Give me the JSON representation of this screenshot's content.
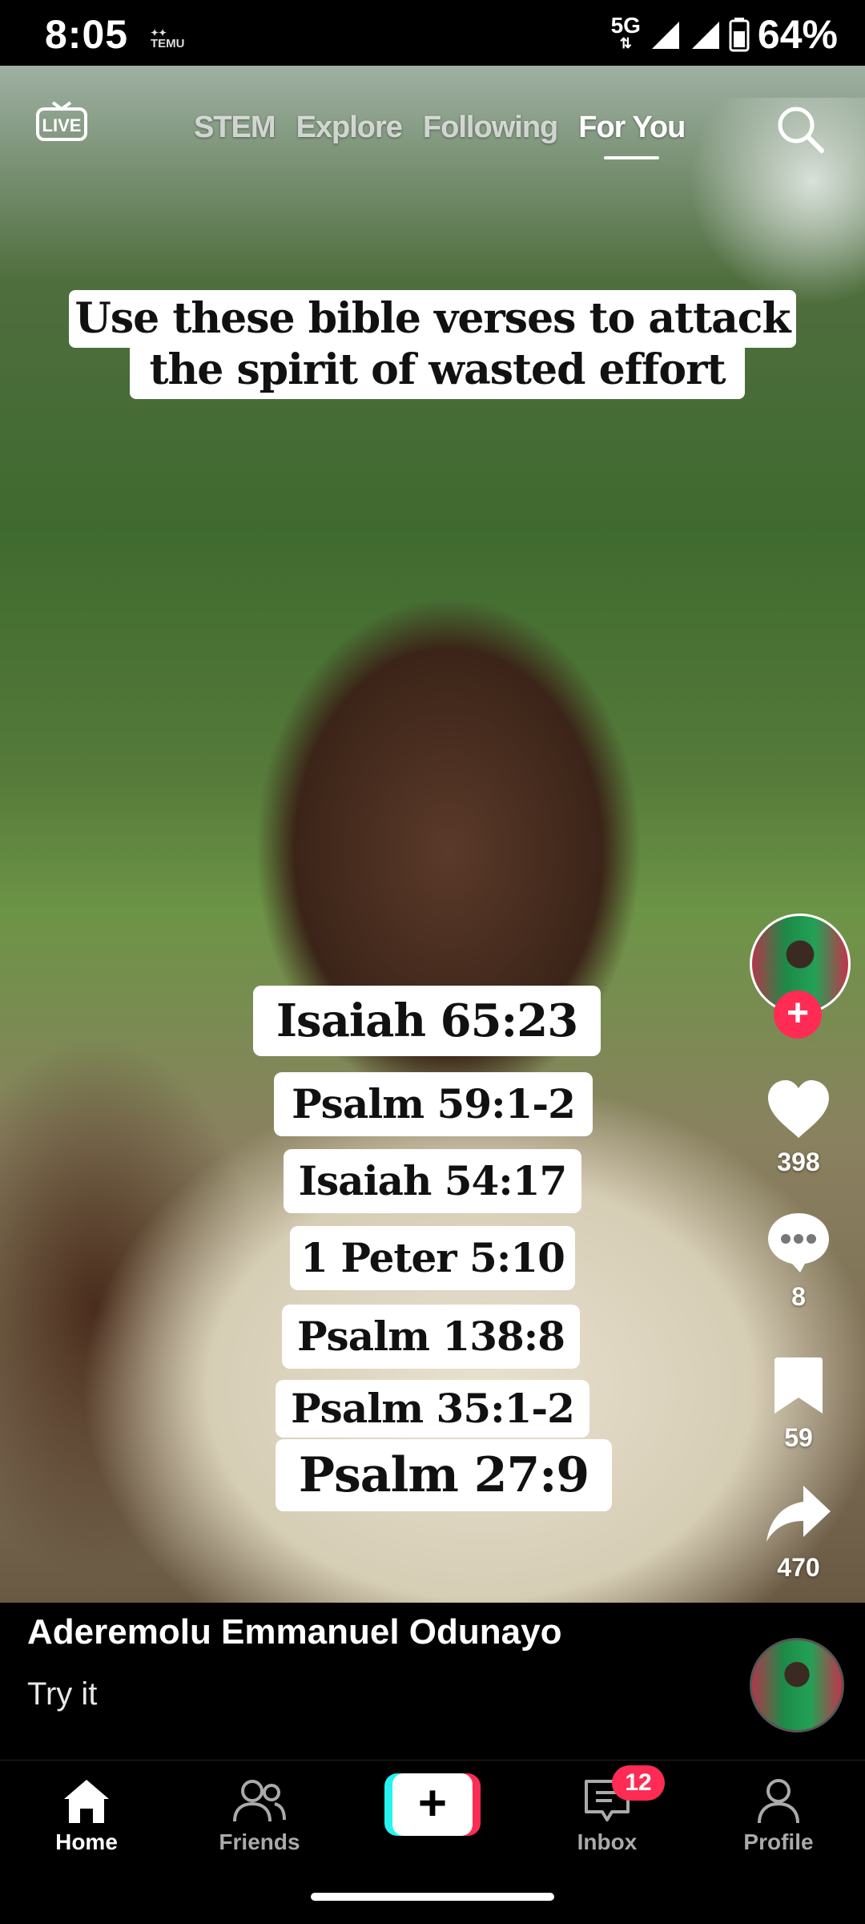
{
  "status_bar": {
    "time": "8:05",
    "notif_app": "TEMU",
    "network": "5G",
    "battery": "64%"
  },
  "top_nav": {
    "live_label": "LIVE",
    "tabs": [
      {
        "label": "STEM",
        "active": false
      },
      {
        "label": "Explore",
        "active": false
      },
      {
        "label": "Following",
        "active": false
      },
      {
        "label": "For You",
        "active": true
      }
    ]
  },
  "video": {
    "caption_line1": "Use these bible verses to attack",
    "caption_line2": "the spirit of wasted effort",
    "verses": [
      "Isaiah 65:23",
      "Psalm 59:1-2",
      "Isaiah 54:17",
      "1 Peter 5:10",
      "Psalm 138:8",
      "Psalm 35:1-2",
      "Psalm 27:9"
    ]
  },
  "actions": {
    "likes": "398",
    "comments": "8",
    "saves": "59",
    "shares": "470"
  },
  "post": {
    "author": "Aderemolu Emmanuel Odunayo",
    "description": "Try it"
  },
  "tab_bar": {
    "home": "Home",
    "friends": "Friends",
    "inbox": "Inbox",
    "inbox_badge": "12",
    "profile": "Profile"
  },
  "colors": {
    "accent_red": "#fe2c55",
    "accent_cyan": "#25f4ee"
  }
}
